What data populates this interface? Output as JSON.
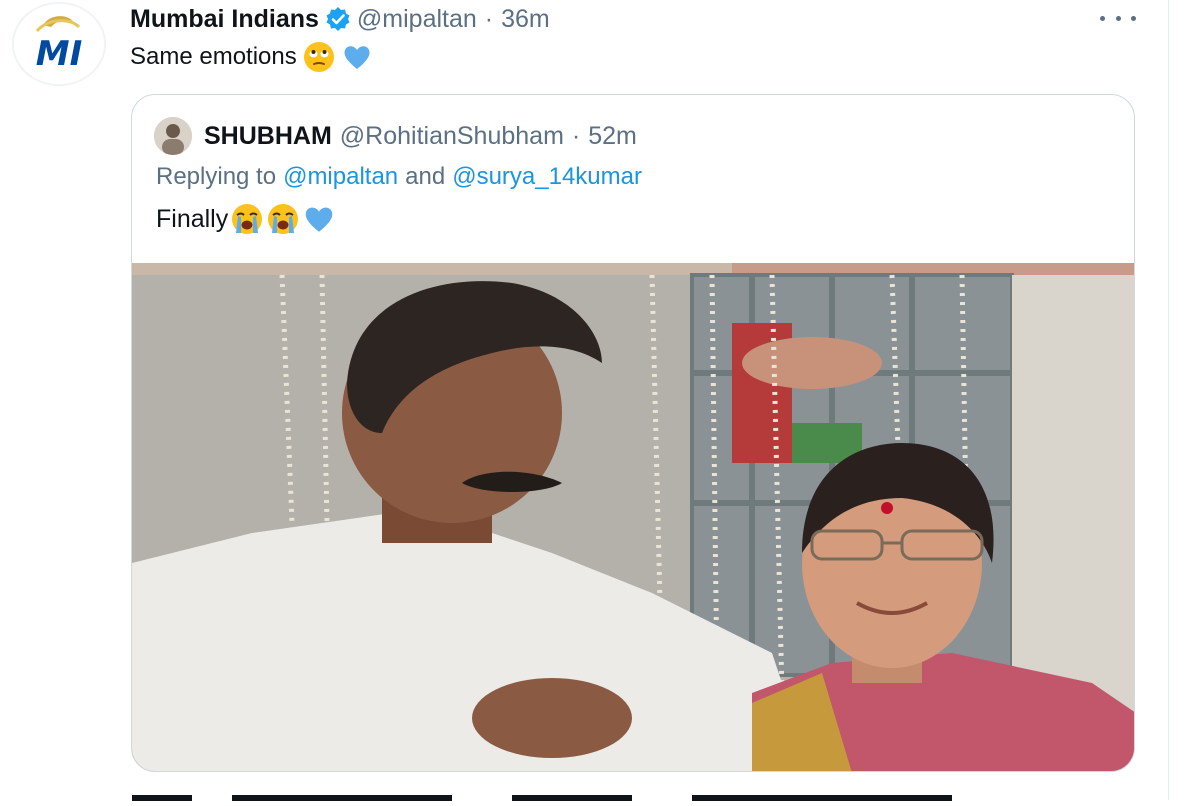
{
  "tweet": {
    "author_name": "Mumbai Indians",
    "handle": "@mipaltan",
    "separator": "·",
    "time": "36m",
    "text": "Same emotions",
    "emojis": [
      "rolling-eyes-emoji",
      "blue-heart-emoji"
    ],
    "verified": true,
    "avatar_logo": "MI"
  },
  "quoted_tweet": {
    "author_name": "SHUBHAM",
    "handle": "@RohitianShubham",
    "separator": "·",
    "time": "52m",
    "replying_prefix": "Replying to",
    "replying_mention_1": "@mipaltan",
    "replying_and": "and",
    "replying_mention_2": "@surya_14kumar",
    "text": "Finally",
    "emojis": [
      "loudly-crying-emoji",
      "loudly-crying-emoji",
      "blue-heart-emoji"
    ]
  },
  "colors": {
    "text": "#0f1419",
    "secondary": "#5b7083",
    "link": "#1b95e0",
    "verified": "#1da1f2",
    "border": "#cfd9de",
    "mi_blue": "#004ba0",
    "mi_gold": "#d4af37"
  }
}
